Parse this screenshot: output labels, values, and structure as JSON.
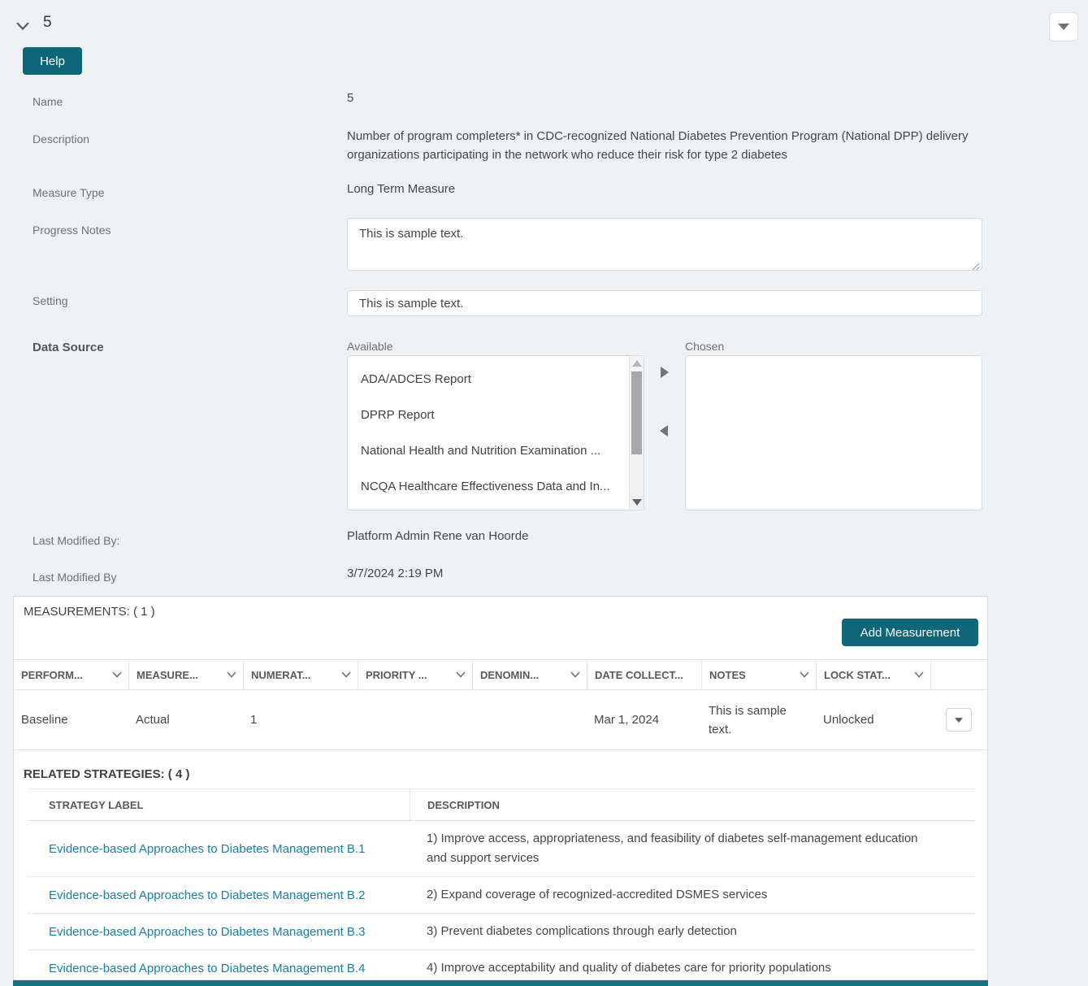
{
  "header": {
    "title": "5",
    "help_label": "Help"
  },
  "fields": {
    "name": {
      "label": "Name",
      "value": "5"
    },
    "description": {
      "label": "Description",
      "value": "Number of program completers* in CDC-recognized National Diabetes Prevention Program (National DPP) delivery organizations participating in the network who reduce their risk for type 2 diabetes"
    },
    "measure_type": {
      "label": "Measure Type",
      "value": "Long Term Measure"
    },
    "progress_notes": {
      "label": "Progress Notes",
      "value": "This is sample text."
    },
    "setting": {
      "label": "Setting",
      "value": "This is sample text."
    },
    "data_source": {
      "label": "Data Source",
      "available_label": "Available",
      "chosen_label": "Chosen",
      "available_options": [
        "ADA/ADCES Report",
        "DPRP Report",
        "National Health and Nutrition Examination ...",
        "NCQA Healthcare Effectiveness Data and In..."
      ],
      "chosen_options": []
    },
    "last_modified_by_name": {
      "label": "Last Modified By:",
      "value": "Platform Admin Rene van Hoorde"
    },
    "last_modified_by_date": {
      "label": "Last Modified By",
      "value": "3/7/2024 2:19 PM"
    }
  },
  "measurements": {
    "title": "MEASUREMENTS: ( 1 )",
    "add_button_label": "Add Measurement",
    "columns": [
      "PERFORM...",
      "MEASURE...",
      "NUMERAT...",
      "PRIORITY ...",
      "DENOMIN...",
      "DATE COLLECT...",
      "NOTES",
      "LOCK STAT..."
    ],
    "rows": [
      [
        "Baseline",
        "Actual",
        "1",
        "",
        "",
        "Mar 1, 2024",
        "This is sample text.",
        "Unlocked"
      ]
    ]
  },
  "related_strategies": {
    "title": "RELATED STRATEGIES: ( 4 )",
    "col_label": "STRATEGY LABEL",
    "col_desc": "DESCRIPTION",
    "rows": [
      {
        "label": "Evidence-based Approaches to Diabetes Management B.1",
        "description": "1) Improve access, appropriateness, and feasibility of diabetes self-management education and support services"
      },
      {
        "label": "Evidence-based Approaches to Diabetes Management B.2",
        "description": "2) Expand coverage of recognized-accredited DSMES services"
      },
      {
        "label": "Evidence-based Approaches to Diabetes Management B.3",
        "description": "3) Prevent diabetes complications through early detection"
      },
      {
        "label": "Evidence-based Approaches to Diabetes Management B.4",
        "description": "4) Improve acceptability and quality of diabetes care for priority populations"
      }
    ]
  },
  "colors": {
    "accent_teal": "#0e6778",
    "link": "#1a80a3",
    "page_background": "#eef2f5"
  }
}
